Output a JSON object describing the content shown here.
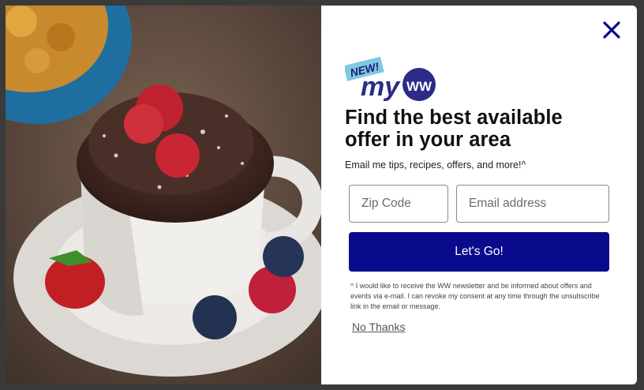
{
  "modal": {
    "close_icon": "close-icon",
    "image": {
      "description_icon": "mug-cake-photo"
    },
    "logo": {
      "badge": "NEW!",
      "wordmark": "my",
      "mark": "WW"
    },
    "headline": "Find the best available offer in your area",
    "subtext": "Email me tips, recipes, offers, and more!^",
    "zip_placeholder": "Zip Code",
    "email_placeholder": "Email address",
    "submit_label": "Let's Go!",
    "legal": "^ I would like to receive the WW newsletter and be informed about offers and events via e-mail. I can revoke my consent at any time through the unsubscribe link in the email or message.",
    "dismiss_label": "No Thanks"
  },
  "colors": {
    "primary": "#0a0a8c",
    "logo_navy": "#2b2b88",
    "badge_blue": "#7ec8e3",
    "close": "#0a0a8c"
  }
}
